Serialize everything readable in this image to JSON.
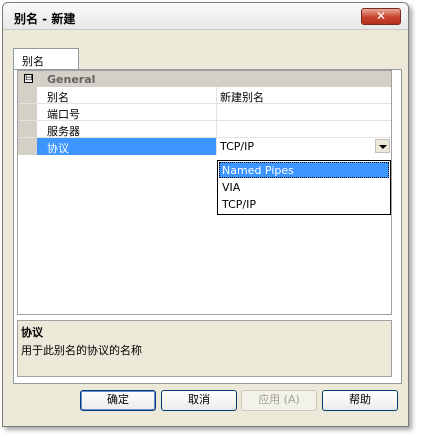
{
  "window": {
    "title": "别名 - 新建",
    "close_glyph": "✕"
  },
  "tabs": [
    {
      "label": "别名"
    }
  ],
  "category": {
    "toggle": "⊟",
    "label": "General"
  },
  "properties": [
    {
      "name": "别名",
      "value": "新建别名"
    },
    {
      "name": "端口号",
      "value": ""
    },
    {
      "name": "服务器",
      "value": ""
    },
    {
      "name": "协议",
      "value": "TCP/IP"
    }
  ],
  "dropdown": {
    "options": [
      "Named Pipes",
      "VIA",
      "TCP/IP"
    ],
    "highlighted": "Named Pipes"
  },
  "description": {
    "title": "协议",
    "text": "用于此别名的协议的名称"
  },
  "buttons": {
    "ok": "确定",
    "cancel": "取消",
    "apply": "应用 (A)",
    "help": "帮助"
  }
}
